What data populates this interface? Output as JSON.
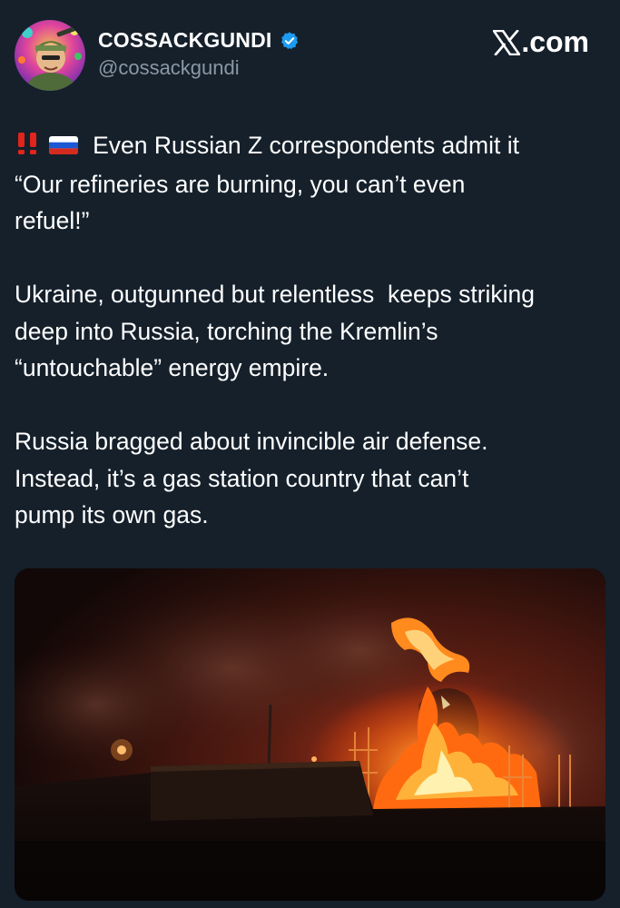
{
  "header": {
    "display_name": "COSSACKGUNDI",
    "handle": "@cossackgundi",
    "brand_suffix": ".com",
    "verified": true,
    "accent_color": "#1d9bf0"
  },
  "tweet": {
    "emoji_icons": [
      "double-exclamation-icon",
      "russia-flag-icon"
    ],
    "lines": [
      "Even Russian Z correspondents admit it",
      "“Our refineries are burning, you can’t even",
      "refuel!”",
      "",
      "Ukraine, outgunned but relentless  keeps striking",
      "deep into Russia, torching the Kremlin’s",
      "“untouchable” energy empire.",
      "",
      "Russia bragged about invincible air defense.",
      "Instead, it’s a gas station country that can’t",
      "pump its own gas."
    ]
  },
  "media": {
    "subject": "refinery-fire-photo"
  }
}
